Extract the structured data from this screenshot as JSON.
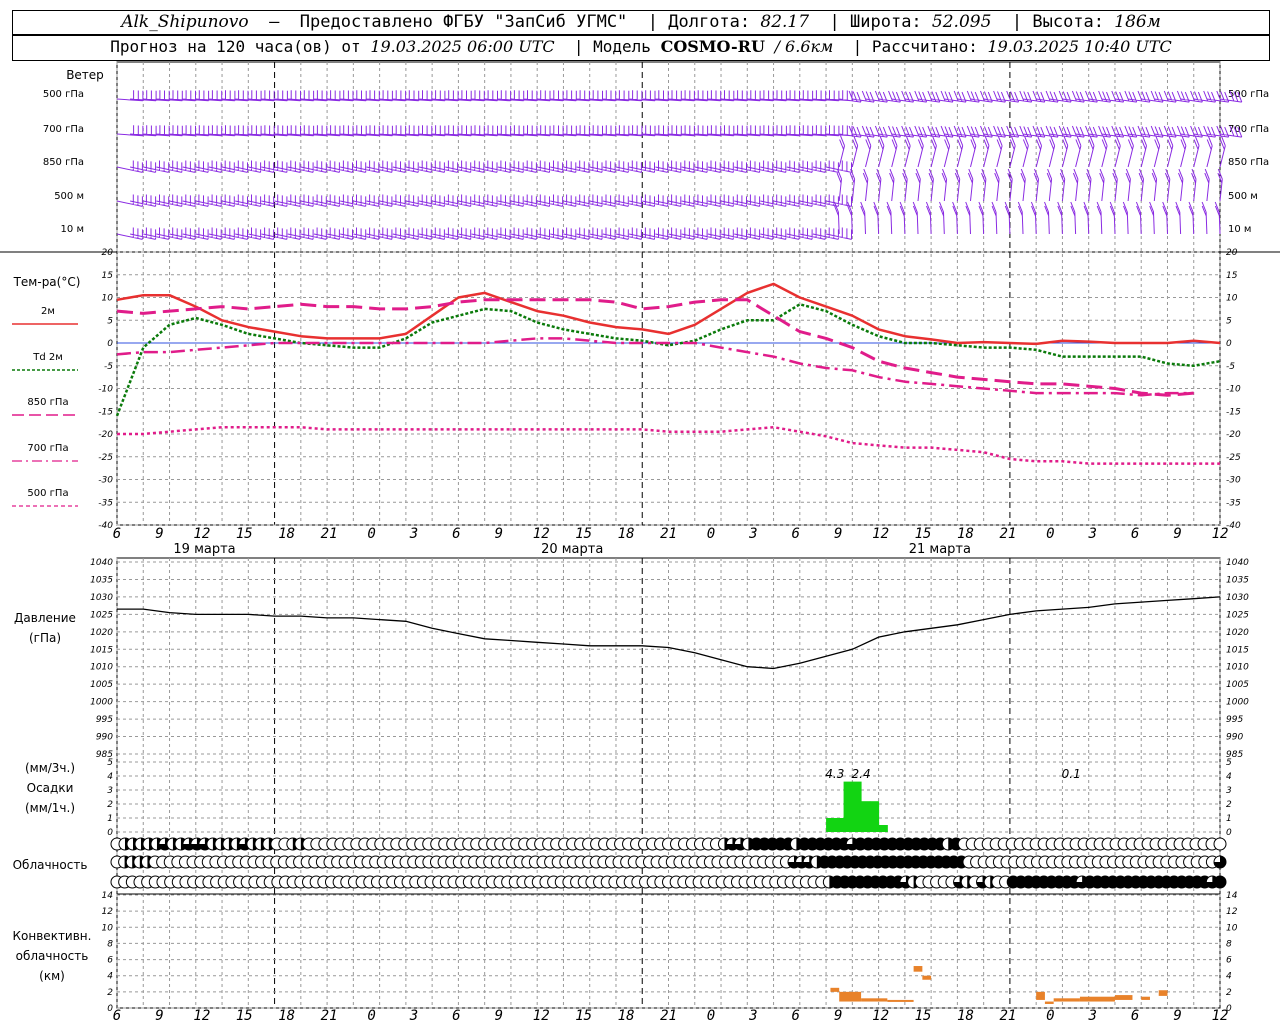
{
  "header": {
    "station": "Alk_Shipunovo",
    "provider": "Предоставлено ФГБУ \"ЗапСиб УГМС\"",
    "lon_label": "Долгота:",
    "lon": "82.17",
    "lat_label": "Широта:",
    "lat": "52.095",
    "alt_label": "Высота:",
    "alt": "186м",
    "forecast_prefix": "Прогноз на 120 часа(ов) от",
    "forecast_from": "19.03.2025 06:00 UTC",
    "model_label": "Модель",
    "model": "COSMO-RU",
    "model_res": "/ 6.6км",
    "calc_label": "Рассчитано:",
    "calc_time": "19.03.2025 10:40 UTC"
  },
  "labels": {
    "wind": "Ветер",
    "wind_levels": [
      "500 гПа",
      "700 гПа",
      "850 гПа",
      "500 м",
      "10  м"
    ],
    "temp": "Тем-ра(°C)",
    "temp_legend": [
      "2м",
      "Td  2м",
      "850 гПа",
      "700 гПа",
      "500 гПа"
    ],
    "pressure": "Давление",
    "pressure_unit": "(гПа)",
    "precip_unit3": "(мм/3ч.)",
    "precip": "Осадки",
    "precip_unit1": "(мм/1ч.)",
    "cloud": "Облачность",
    "conv1": "Конвективн.",
    "conv2": "облачность",
    "conv3": "(км)",
    "dates": [
      "19 марта",
      "20 марта",
      "21 марта"
    ],
    "x_ticks": [
      "6",
      "9",
      "12",
      "15",
      "18",
      "21",
      "0",
      "3",
      "6",
      "9",
      "12",
      "15",
      "18",
      "21",
      "0",
      "3",
      "6",
      "9",
      "12",
      "15",
      "18",
      "21",
      "0",
      "3",
      "6",
      "9",
      "12"
    ]
  },
  "colors": {
    "t2m": "#e83030",
    "td2m": "#0a7a0a",
    "t850": "#e01c8a",
    "t700": "#e01c8a",
    "t500": "#e01c8a",
    "wind": "#8a2be2",
    "precip": "#12d412",
    "conv": "#e8822a",
    "zero_line": "#3050e0"
  },
  "chart_data": [
    {
      "type": "line",
      "title": "Тем-ра(°C)",
      "x_hours": [
        0,
        3,
        6,
        9,
        12,
        15,
        18,
        21,
        24,
        27,
        30,
        33,
        36,
        39,
        42,
        45,
        48,
        51,
        54,
        57,
        60,
        63,
        66,
        69,
        72,
        75,
        78,
        81,
        84,
        87,
        90,
        93,
        96,
        99,
        102,
        105,
        108,
        111,
        114,
        117,
        120,
        123,
        126
      ],
      "ylim": [
        -40,
        20
      ],
      "series": [
        {
          "name": "2м",
          "values": [
            9.5,
            10.5,
            10.5,
            8,
            5,
            3.5,
            2.5,
            1.5,
            1,
            1,
            1,
            2,
            6,
            10,
            11,
            9,
            7,
            6,
            4.5,
            3.5,
            3,
            2,
            4,
            7.5,
            11,
            13,
            10,
            8,
            6,
            3,
            1.5,
            0.8,
            0,
            0.2,
            0,
            -0.2,
            0.5,
            0.3,
            0,
            0,
            0,
            0.5,
            0
          ]
        },
        {
          "name": "Td  2м",
          "values": [
            -16,
            -1,
            4,
            5.5,
            4,
            2,
            1,
            0,
            -0.5,
            -1,
            -1,
            1,
            4.5,
            6,
            7.5,
            7,
            4.5,
            3,
            2,
            1,
            0.5,
            -0.5,
            0.5,
            3,
            5,
            5,
            8.5,
            7,
            4,
            1.5,
            0,
            0,
            -0.5,
            -1,
            -1,
            -1.5,
            -3,
            -3,
            -3,
            -3,
            -4.5,
            -5,
            -4
          ]
        },
        {
          "name": "850 гПа",
          "values": [
            7,
            6.5,
            7,
            7.5,
            8,
            7.5,
            8,
            8.5,
            8,
            8,
            7.5,
            7.5,
            8,
            9,
            9.5,
            9.5,
            9.5,
            9.5,
            9.5,
            9,
            7.5,
            8,
            9,
            9.5,
            9.5,
            6,
            2.5,
            1,
            -1,
            -4,
            -5.5,
            -6.5,
            -7.5,
            -8,
            -8.5,
            -9,
            -9,
            -9.5,
            -10,
            -11,
            -11.5,
            -11
          ]
        },
        {
          "name": "700 гПа",
          "values": [
            -2.5,
            -2,
            -2,
            -1.5,
            -1,
            -0.5,
            0,
            0,
            0,
            0,
            0,
            0,
            0,
            0,
            0,
            0.5,
            1,
            1,
            0.5,
            0,
            0,
            0,
            0,
            -1,
            -2,
            -3,
            -4.5,
            -5.5,
            -6,
            -7.5,
            -8.5,
            -9,
            -9.5,
            -10,
            -10.5,
            -11,
            -11,
            -11,
            -11,
            -11.5,
            -11,
            -11
          ]
        },
        {
          "name": "500 гПа",
          "values": [
            -20,
            -20,
            -19.5,
            -19,
            -18.5,
            -18.5,
            -18.5,
            -18.5,
            -19,
            -19,
            -19,
            -19,
            -19,
            -19,
            -19,
            -19,
            -19,
            -19,
            -19,
            -19,
            -19,
            -19.5,
            -19.5,
            -19.5,
            -19,
            -18.5,
            -19.5,
            -20.5,
            -22,
            -22.5,
            -23,
            -23,
            -23.5,
            -24,
            -25.5,
            -26,
            -26,
            -26.5,
            -26.5,
            -26.5,
            -26.5,
            -26.5,
            -26.5
          ]
        }
      ]
    },
    {
      "type": "line",
      "title": "Давление",
      "ylabel": "(гПа)",
      "ylim": [
        985,
        1040
      ],
      "x_hours": [
        0,
        3,
        6,
        9,
        12,
        15,
        18,
        21,
        24,
        27,
        30,
        33,
        36,
        39,
        42,
        45,
        48,
        51,
        54,
        57,
        60,
        63,
        66,
        69,
        72,
        75,
        78,
        81,
        84,
        87,
        90,
        93,
        96,
        99,
        102,
        105,
        108,
        111,
        114,
        117,
        120,
        123,
        126
      ],
      "series": [
        {
          "name": "",
          "values": [
            1026.5,
            1026.5,
            1025.5,
            1025,
            1025,
            1025,
            1024.5,
            1024.5,
            1024,
            1024,
            1023.5,
            1023,
            1021,
            1019.5,
            1018,
            1017.5,
            1017,
            1016.5,
            1016,
            1016,
            1016,
            1015.5,
            1014,
            1012,
            1010,
            1009.5,
            1011,
            1013,
            1015,
            1018.5,
            1020,
            1021,
            1022,
            1023.5,
            1025,
            1026,
            1026.5,
            1027,
            1028,
            1028.5,
            1029,
            1029.5,
            1030
          ]
        }
      ]
    },
    {
      "type": "bar",
      "title": "Осадки",
      "ylim": [
        0,
        5
      ],
      "x_hours": [
        81,
        82,
        83,
        84,
        85,
        86,
        87
      ],
      "values": [
        1,
        1,
        3.6,
        3.6,
        2.2,
        2.2,
        0.5
      ],
      "annotations": [
        {
          "x_hour": 82,
          "text": "4.3"
        },
        {
          "x_hour": 85,
          "text": "2.4"
        },
        {
          "x_hour": 109,
          "text": "0.1"
        }
      ]
    },
    {
      "type": "bar",
      "title": "Конвективн. облачность",
      "ylabel": "(км)",
      "ylim": [
        0,
        14
      ],
      "segments": [
        {
          "x0": 81.5,
          "x1": 82.5,
          "base": 2.0,
          "top": 2.5
        },
        {
          "x0": 82.5,
          "x1": 85,
          "base": 0.8,
          "top": 2.0
        },
        {
          "x0": 85,
          "x1": 88,
          "base": 0.8,
          "top": 1.2
        },
        {
          "x0": 88,
          "x1": 91,
          "base": 0.8,
          "top": 1.0
        },
        {
          "x0": 91,
          "x1": 92,
          "base": 4.5,
          "top": 5.2
        },
        {
          "x0": 92,
          "x1": 93,
          "base": 3.5,
          "top": 4.0
        },
        {
          "x0": 105,
          "x1": 106,
          "base": 1.0,
          "top": 2.0
        },
        {
          "x0": 106,
          "x1": 107,
          "base": 0.5,
          "top": 0.8
        },
        {
          "x0": 107,
          "x1": 110,
          "base": 0.8,
          "top": 1.2
        },
        {
          "x0": 110,
          "x1": 114,
          "base": 0.8,
          "top": 1.4
        },
        {
          "x0": 114,
          "x1": 116,
          "base": 1.0,
          "top": 1.6
        },
        {
          "x0": 117,
          "x1": 118,
          "base": 1.0,
          "top": 1.4
        },
        {
          "x0": 119,
          "x1": 120,
          "base": 1.5,
          "top": 2.2
        }
      ]
    },
    {
      "type": "table",
      "title": "Облачность",
      "rows_cover_fraction": [
        [
          0,
          0.5,
          0.5,
          0.5,
          0.5,
          0.5,
          0.75,
          0.5,
          0.5,
          0.75,
          0.75,
          0.75,
          0.5,
          0.5,
          0.5,
          0.5,
          0.75,
          0.5,
          0.5,
          0.5,
          0,
          0,
          0.5,
          0.5,
          0,
          0,
          0,
          0,
          0,
          0,
          0,
          0,
          0,
          0,
          0,
          0,
          0,
          0,
          0,
          0,
          0,
          0,
          0,
          0,
          0,
          0,
          0,
          0,
          0,
          0,
          0,
          0,
          0,
          0,
          0,
          0,
          0,
          0,
          0,
          0,
          0,
          0,
          0,
          0,
          0,
          0,
          0,
          0,
          0,
          0,
          0,
          0,
          0,
          0,
          0,
          0,
          0.5,
          0.75,
          0.75,
          0.5,
          1,
          1,
          1,
          1,
          1,
          0.5,
          1,
          1,
          1,
          1,
          1,
          1,
          0.75,
          1,
          1,
          1,
          1,
          1,
          1,
          1,
          1,
          1,
          1,
          1,
          0.5,
          1,
          0,
          0,
          0,
          0,
          0,
          0,
          0,
          0,
          0,
          0,
          0,
          0,
          0,
          0,
          0,
          0,
          0,
          0,
          0,
          0,
          0,
          0,
          0,
          0,
          0,
          0,
          0,
          0,
          0,
          0,
          0,
          0,
          0
        ],
        [
          0,
          0.5,
          0.5,
          0.5,
          0.5,
          0,
          0,
          0,
          0,
          0,
          0,
          0,
          0,
          0,
          0,
          0,
          0,
          0,
          0,
          0,
          0,
          0,
          0,
          0,
          0,
          0,
          0,
          0,
          0,
          0,
          0,
          0,
          0,
          0,
          0,
          0,
          0,
          0,
          0,
          0,
          0,
          0,
          0,
          0,
          0,
          0,
          0,
          0,
          0,
          0,
          0,
          0,
          0,
          0,
          0,
          0,
          0,
          0,
          0,
          0,
          0,
          0,
          0,
          0,
          0,
          0,
          0,
          0,
          0,
          0,
          0,
          0,
          0,
          0,
          0,
          0,
          0,
          0,
          0,
          0,
          0,
          0,
          0,
          0,
          0,
          0,
          0,
          0,
          0,
          0.75,
          0.75,
          0.75,
          0.5,
          1,
          1,
          1,
          1,
          1,
          1,
          1,
          1,
          1,
          1,
          1,
          1,
          1,
          1,
          1,
          1,
          1,
          1,
          1,
          0,
          0,
          0,
          0,
          0,
          0,
          0,
          0,
          0,
          0,
          0,
          0,
          0,
          0,
          0,
          0,
          0,
          0,
          0,
          0,
          0,
          0,
          0,
          0,
          0,
          0,
          0,
          0,
          0,
          0,
          0,
          0,
          0,
          0.75
        ],
        [
          0,
          0,
          0,
          0,
          0,
          0,
          0,
          0,
          0,
          0,
          0,
          0,
          0,
          0,
          0,
          0,
          0,
          0,
          0,
          0,
          0,
          0,
          0,
          0,
          0,
          0,
          0,
          0,
          0,
          0,
          0,
          0,
          0,
          0,
          0,
          0,
          0,
          0,
          0,
          0,
          0,
          0,
          0,
          0,
          0,
          0,
          0,
          0,
          0,
          0,
          0,
          0,
          0,
          0,
          0,
          0,
          0,
          0,
          0,
          0,
          0,
          0,
          0,
          0,
          0,
          0,
          0,
          0,
          0,
          0,
          0,
          0,
          0,
          0,
          0,
          0,
          0,
          0,
          0,
          0,
          0,
          0,
          0,
          0,
          0,
          0,
          0,
          0,
          0,
          0,
          0,
          0,
          0,
          0.5,
          1,
          1,
          1,
          1,
          1,
          1,
          1,
          1,
          1,
          0.75,
          0.5,
          0,
          0,
          0,
          0,
          0,
          0.75,
          0.5,
          0,
          0.75,
          0.5,
          0,
          0,
          1,
          1,
          1,
          1,
          1,
          1,
          1,
          1,
          1,
          0.75,
          1,
          1,
          1,
          1,
          1,
          1,
          1,
          1,
          1,
          1,
          1,
          1,
          1,
          1,
          1,
          1,
          0.75,
          1
        ]
      ]
    }
  ]
}
